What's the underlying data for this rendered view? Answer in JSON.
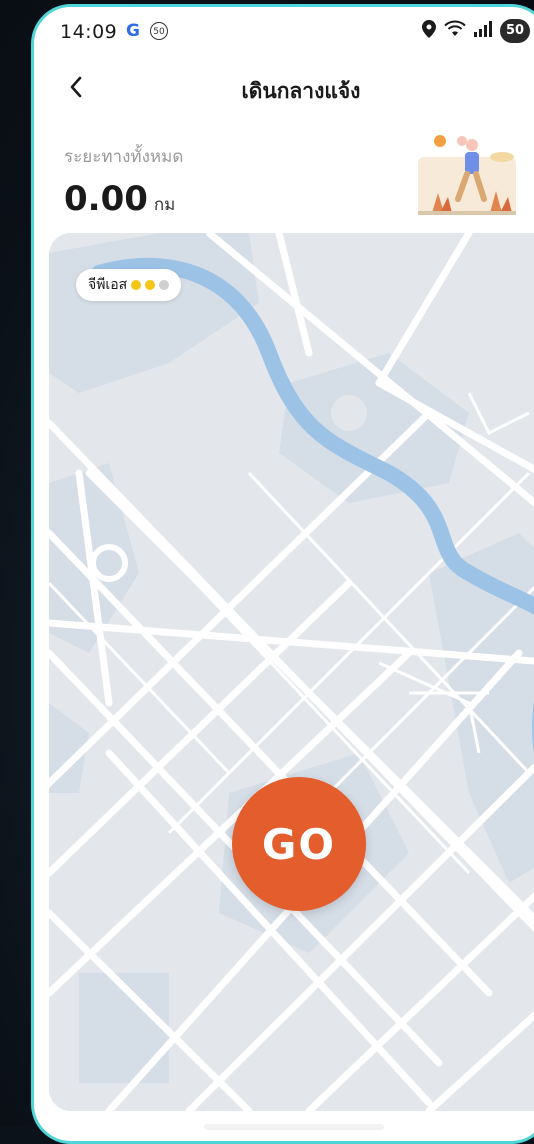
{
  "status_bar": {
    "time": "14:09",
    "g_label": "G",
    "speed_badge": "50",
    "battery": "50"
  },
  "header": {
    "title": "เดินกลางแจ้ง"
  },
  "distance": {
    "label": "ระยะทางทั้งหมด",
    "value": "0.00",
    "unit": "กม"
  },
  "gps": {
    "label": "จีพีเอส",
    "dots": [
      "#f5c518",
      "#f5c518",
      "#cfcfcf"
    ]
  },
  "go_button": {
    "label": "GO"
  },
  "colors": {
    "accent": "#e45d2c",
    "frame": "#4fd4d8",
    "river": "#9cc3e6",
    "map_bg": "#e3e7ec",
    "map_block": "#d4dde7"
  }
}
